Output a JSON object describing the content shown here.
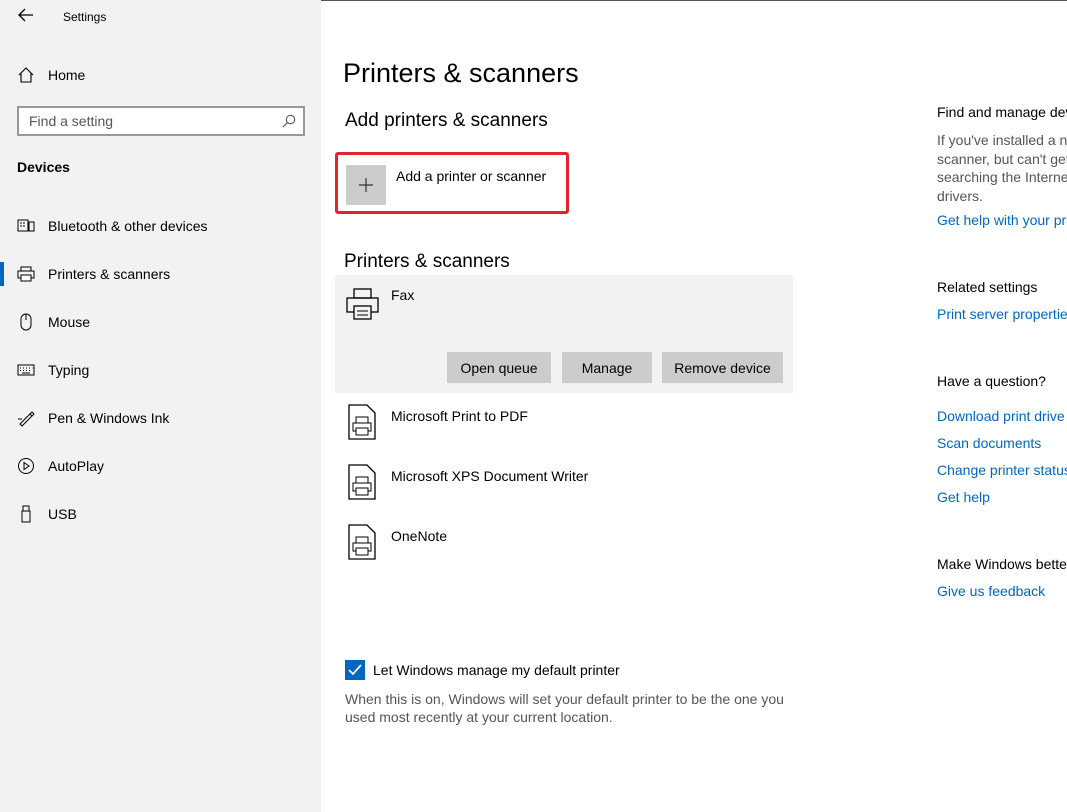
{
  "window": {
    "title": "Settings"
  },
  "sidebar": {
    "home_label": "Home",
    "search_placeholder": "Find a setting",
    "section": "Devices",
    "items": [
      {
        "label": "Bluetooth & other devices",
        "icon": "bluetooth-devices-icon"
      },
      {
        "label": "Printers & scanners",
        "icon": "printer-icon",
        "active": true
      },
      {
        "label": "Mouse",
        "icon": "mouse-icon"
      },
      {
        "label": "Typing",
        "icon": "keyboard-icon"
      },
      {
        "label": "Pen & Windows Ink",
        "icon": "pen-icon"
      },
      {
        "label": "AutoPlay",
        "icon": "autoplay-icon"
      },
      {
        "label": "USB",
        "icon": "usb-icon"
      }
    ]
  },
  "main": {
    "title": "Printers & scanners",
    "add_heading": "Add printers & scanners",
    "add_button": "Add a printer or scanner",
    "list_heading": "Printers & scanners",
    "printers": [
      {
        "name": "Fax",
        "selected": true
      },
      {
        "name": "Microsoft Print to PDF"
      },
      {
        "name": "Microsoft XPS Document Writer"
      },
      {
        "name": "OneNote"
      }
    ],
    "actions": {
      "open_queue": "Open queue",
      "manage": "Manage",
      "remove": "Remove device"
    },
    "default_printer": {
      "label": "Let Windows manage my default printer",
      "checked": true,
      "description": "When this is on, Windows will set your default printer to be the one you used most recently at your current location."
    }
  },
  "right": {
    "find_heading": "Find and manage dev",
    "find_text": [
      "If you've installed a n",
      "scanner, but can't get",
      "searching the Interne",
      "drivers."
    ],
    "find_link": "Get help with your pr",
    "related_heading": "Related settings",
    "related_link": "Print server propertie",
    "question_heading": "Have a question?",
    "question_links": [
      "Download print drive",
      "Scan documents",
      "Change printer status",
      "Get help"
    ],
    "feedback_heading": "Make Windows bette",
    "feedback_link": "Give us feedback"
  },
  "colors": {
    "accent": "#0067c0",
    "highlight_border": "#e0262c",
    "sidebar_bg": "#f2f2f2"
  }
}
